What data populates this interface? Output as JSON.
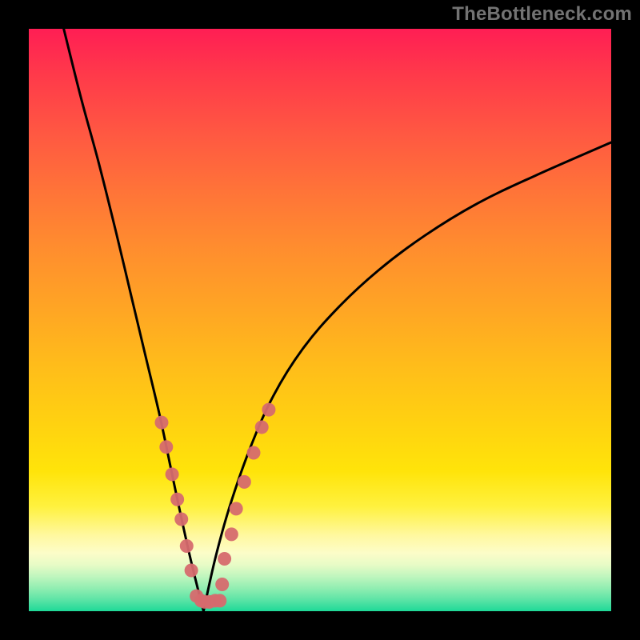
{
  "watermark": {
    "text": "TheBottleneck.com"
  },
  "chart_data": {
    "type": "line",
    "title": "",
    "xlabel": "",
    "ylabel": "",
    "xrange": [
      0,
      1
    ],
    "yrange": [
      0,
      1
    ],
    "series": [
      {
        "name": "left-curve",
        "x": [
          0.06,
          0.09,
          0.12,
          0.15,
          0.175,
          0.2,
          0.225,
          0.245,
          0.262,
          0.28,
          0.3
        ],
        "y": [
          1.0,
          0.88,
          0.77,
          0.65,
          0.545,
          0.44,
          0.335,
          0.24,
          0.16,
          0.08,
          0.0
        ]
      },
      {
        "name": "right-curve",
        "x": [
          0.3,
          0.32,
          0.345,
          0.38,
          0.42,
          0.47,
          0.53,
          0.6,
          0.68,
          0.77,
          0.87,
          1.0
        ],
        "y": [
          0.0,
          0.09,
          0.18,
          0.28,
          0.37,
          0.45,
          0.52,
          0.585,
          0.645,
          0.7,
          0.748,
          0.805
        ]
      }
    ],
    "markers": {
      "name": "datapoints",
      "color": "#d66a6e",
      "xy": [
        [
          0.228,
          0.324
        ],
        [
          0.236,
          0.282
        ],
        [
          0.246,
          0.235
        ],
        [
          0.255,
          0.192
        ],
        [
          0.262,
          0.158
        ],
        [
          0.271,
          0.112
        ],
        [
          0.279,
          0.07
        ],
        [
          0.288,
          0.026
        ],
        [
          0.296,
          0.018
        ],
        [
          0.302,
          0.016
        ],
        [
          0.31,
          0.016
        ],
        [
          0.32,
          0.018
        ],
        [
          0.328,
          0.018
        ],
        [
          0.332,
          0.046
        ],
        [
          0.336,
          0.09
        ],
        [
          0.348,
          0.132
        ],
        [
          0.356,
          0.176
        ],
        [
          0.37,
          0.222
        ],
        [
          0.386,
          0.272
        ],
        [
          0.4,
          0.316
        ],
        [
          0.412,
          0.346
        ]
      ]
    }
  }
}
